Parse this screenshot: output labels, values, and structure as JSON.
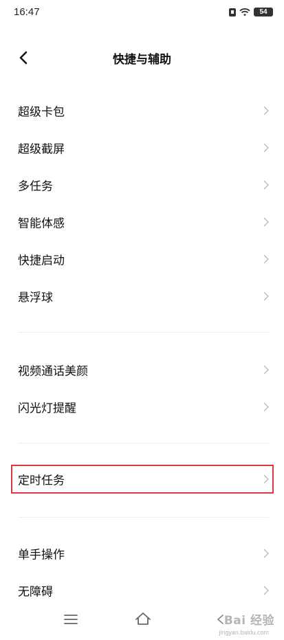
{
  "status_bar": {
    "time": "16:47",
    "battery": "54"
  },
  "header": {
    "title": "快捷与辅助"
  },
  "groups": [
    {
      "items": [
        {
          "label": "超级卡包"
        },
        {
          "label": "超级截屏"
        },
        {
          "label": "多任务"
        },
        {
          "label": "智能体感"
        },
        {
          "label": "快捷启动"
        },
        {
          "label": "悬浮球"
        }
      ]
    },
    {
      "items": [
        {
          "label": "视频通话美颜"
        },
        {
          "label": "闪光灯提醒"
        }
      ]
    },
    {
      "items": [
        {
          "label": "定时任务"
        }
      ]
    },
    {
      "items": [
        {
          "label": "单手操作"
        },
        {
          "label": "无障碍"
        }
      ]
    }
  ],
  "highlight_color": "#d9383f",
  "watermark": {
    "text": "Bai 经验",
    "url": "jingyan.baidu.com"
  }
}
